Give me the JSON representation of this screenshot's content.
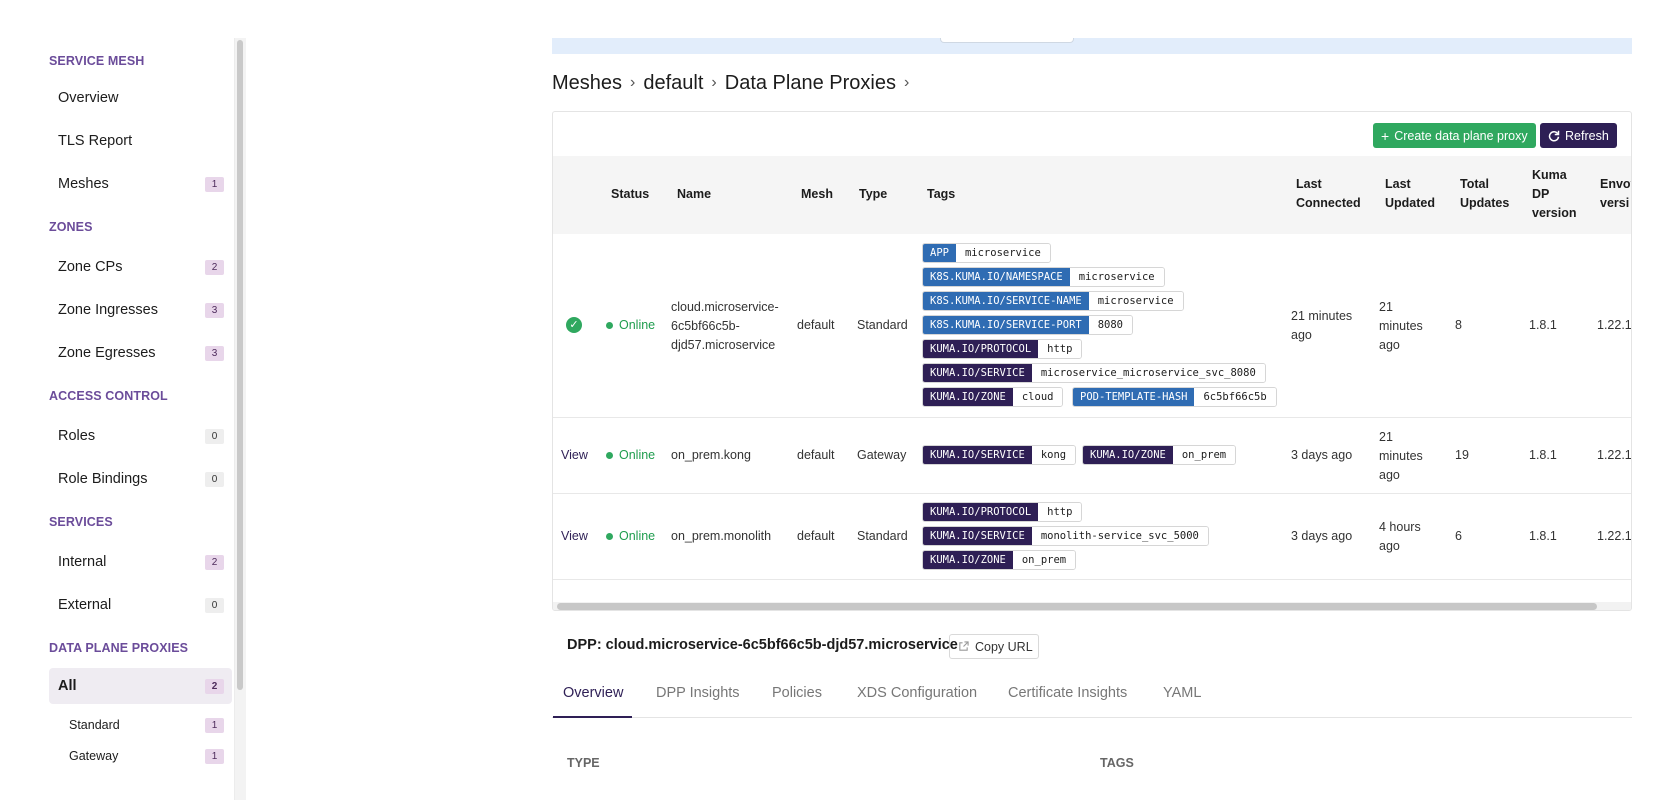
{
  "sidebar": {
    "sections": [
      {
        "title": "SERVICE MESH",
        "items": [
          {
            "label": "Overview",
            "count": ""
          },
          {
            "label": "TLS Report",
            "count": ""
          },
          {
            "label": "Meshes",
            "count": "1"
          }
        ]
      },
      {
        "title": "ZONES",
        "items": [
          {
            "label": "Zone CPs",
            "count": "2"
          },
          {
            "label": "Zone Ingresses",
            "count": "3"
          },
          {
            "label": "Zone Egresses",
            "count": "3"
          }
        ]
      },
      {
        "title": "ACCESS CONTROL",
        "items": [
          {
            "label": "Roles",
            "count": "0"
          },
          {
            "label": "Role Bindings",
            "count": "0"
          }
        ]
      },
      {
        "title": "SERVICES",
        "items": [
          {
            "label": "Internal",
            "count": "2"
          },
          {
            "label": "External",
            "count": "0"
          }
        ]
      },
      {
        "title": "DATA PLANE PROXIES",
        "items": [
          {
            "label": "All",
            "count": "2"
          },
          {
            "label": "Standard",
            "count": "1"
          },
          {
            "label": "Gateway",
            "count": "1"
          }
        ]
      }
    ]
  },
  "breadcrumb": [
    "Meshes",
    "default",
    "Data Plane Proxies"
  ],
  "toolbar": {
    "create_label": "Create data plane proxy",
    "refresh_label": "Refresh"
  },
  "table": {
    "columns": [
      "Status",
      "Name",
      "Mesh",
      "Type",
      "Tags",
      "Last Connected",
      "Last Updated",
      "Total Updates",
      "Kuma DP version",
      "Envoy version"
    ],
    "column_header_lines": {
      "last_connected": [
        "Last",
        "Connected"
      ],
      "last_updated": [
        "Last",
        "Updated"
      ],
      "total_updates": [
        "Total",
        "Updates"
      ],
      "kuma_dp": [
        "Kuma",
        "DP",
        "version"
      ],
      "envoy": [
        "Envoy",
        "versi"
      ]
    },
    "rows": [
      {
        "action": "",
        "status": "Online",
        "name_lines": [
          "cloud.microservice-",
          "6c5bf66c5b-",
          "djd57.microservice"
        ],
        "mesh": "default",
        "type": "Standard",
        "tags": [
          {
            "k": "APP",
            "v": "microservice"
          },
          {
            "k": "K8S.KUMA.IO/NAMESPACE",
            "v": "microservice"
          },
          {
            "k": "K8S.KUMA.IO/SERVICE-NAME",
            "v": "microservice"
          },
          {
            "k": "K8S.KUMA.IO/SERVICE-PORT",
            "v": "8080"
          },
          {
            "k": "KUMA.IO/PROTOCOL",
            "v": "http"
          },
          {
            "k": "KUMA.IO/SERVICE",
            "v": "microservice_microservice_svc_8080"
          },
          {
            "k": "KUMA.IO/ZONE",
            "v": "cloud"
          },
          {
            "k": "POD-TEMPLATE-HASH",
            "v": "6c5bf66c5b"
          }
        ],
        "last_connected_lines": [
          "21 minutes",
          "ago"
        ],
        "last_updated_lines": [
          "21",
          "minutes",
          "ago"
        ],
        "total_updates": "8",
        "kuma_dp": "1.8.1",
        "envoy": "1.22.1"
      },
      {
        "action": "View",
        "status": "Online",
        "name_lines": [
          "on_prem.kong"
        ],
        "mesh": "default",
        "type": "Gateway",
        "tags": [
          {
            "k": "KUMA.IO/SERVICE",
            "v": "kong"
          },
          {
            "k": "KUMA.IO/ZONE",
            "v": "on_prem"
          }
        ],
        "last_connected_lines": [
          "3 days ago"
        ],
        "last_updated_lines": [
          "21",
          "minutes",
          "ago"
        ],
        "total_updates": "19",
        "kuma_dp": "1.8.1",
        "envoy": "1.22.1"
      },
      {
        "action": "View",
        "status": "Online",
        "name_lines": [
          "on_prem.monolith"
        ],
        "mesh": "default",
        "type": "Standard",
        "tags": [
          {
            "k": "KUMA.IO/PROTOCOL",
            "v": "http"
          },
          {
            "k": "KUMA.IO/SERVICE",
            "v": "monolith-service_svc_5000"
          },
          {
            "k": "KUMA.IO/ZONE",
            "v": "on_prem"
          }
        ],
        "last_connected_lines": [
          "3 days ago"
        ],
        "last_updated_lines": [
          "4 hours",
          "ago"
        ],
        "total_updates": "6",
        "kuma_dp": "1.8.1",
        "envoy": "1.22.1"
      }
    ]
  },
  "detail": {
    "title": "DPP: cloud.microservice-6c5bf66c5b-djd57.microservice",
    "copy_url_label": "Copy URL",
    "tabs": [
      "Overview",
      "DPP Insights",
      "Policies",
      "XDS Configuration",
      "Certificate Insights",
      "YAML"
    ],
    "labels": {
      "type": "TYPE",
      "tags": "TAGS"
    }
  },
  "colors": {
    "accent": "#2e1f55",
    "success": "#2fa85f",
    "tag_blue": "#2f6cb3",
    "section": "#6b4c9a"
  }
}
